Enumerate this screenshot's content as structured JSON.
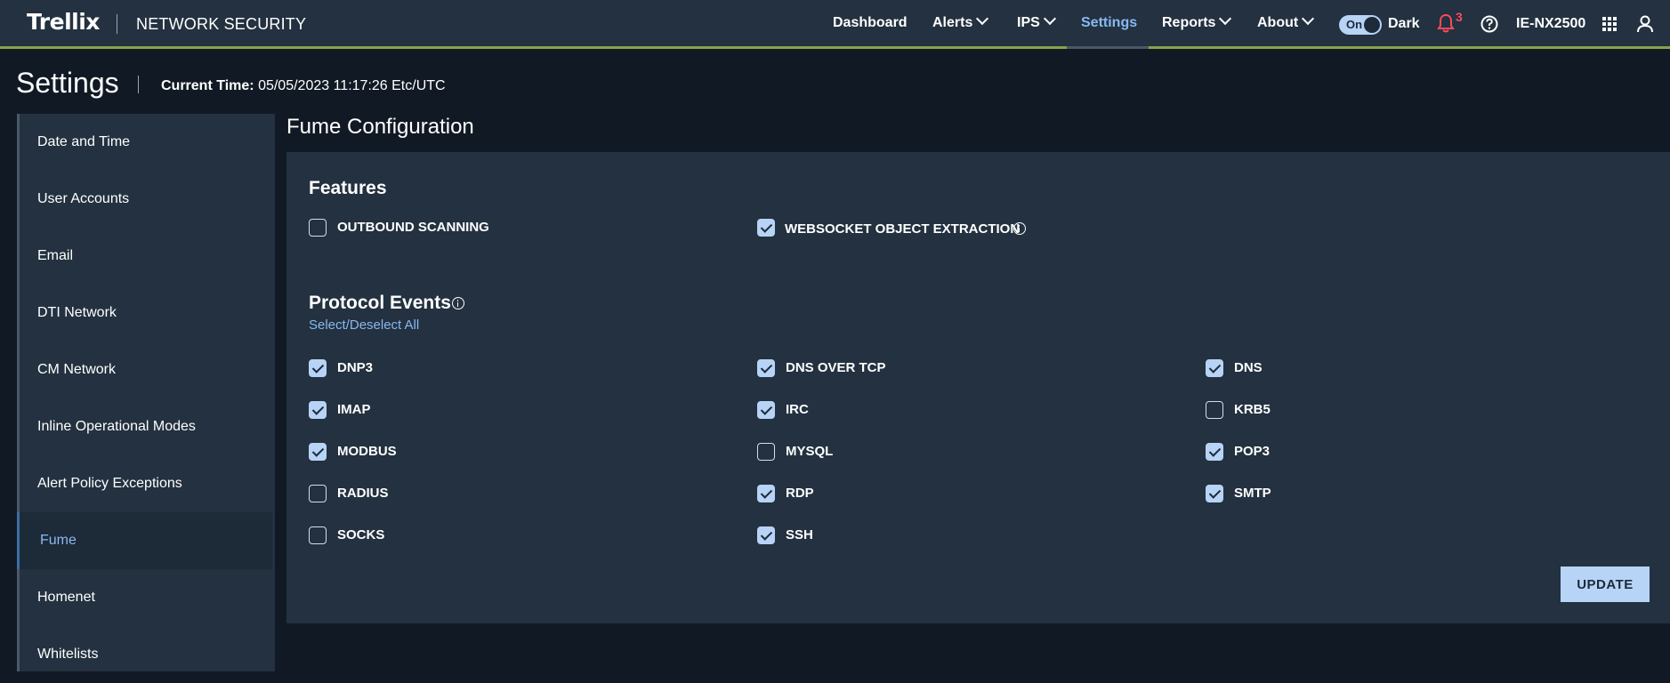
{
  "header": {
    "logo": "Trellix",
    "product": "NETWORK SECURITY",
    "nav": [
      {
        "label": "Dashboard"
      },
      {
        "label": "Alerts"
      },
      {
        "label": "IPS"
      },
      {
        "label": "Settings"
      },
      {
        "label": "Reports"
      },
      {
        "label": "About"
      }
    ],
    "toggle_label": "On",
    "theme_label": "Dark",
    "notification_count": "3",
    "device_name": "IE-NX2500",
    "accent_color": "#8ab8f0",
    "alert_color": "#ff4a5a"
  },
  "page": {
    "title": "Settings",
    "time_label": "Current Time:",
    "time_value": "05/05/2023 11:17:26 Etc/UTC"
  },
  "sidebar": {
    "items": [
      {
        "label": "Date and Time"
      },
      {
        "label": "User Accounts"
      },
      {
        "label": "Email"
      },
      {
        "label": "DTI Network"
      },
      {
        "label": "CM Network"
      },
      {
        "label": "Inline Operational Modes"
      },
      {
        "label": "Alert Policy Exceptions"
      },
      {
        "label": "Fume"
      },
      {
        "label": "Homenet"
      },
      {
        "label": "Whitelists"
      }
    ],
    "active": "Fume"
  },
  "main": {
    "title": "Fume Configuration",
    "features": {
      "title": "Features",
      "items": [
        {
          "label": "OUTBOUND SCANNING",
          "checked": false
        },
        {
          "label": "WEBSOCKET OBJECT EXTRACTION",
          "checked": true
        }
      ]
    },
    "protocol_events": {
      "title": "Protocol Events",
      "select_all": "Select/Deselect All",
      "items": [
        {
          "label": "DNP3",
          "checked": true
        },
        {
          "label": "DNS OVER TCP",
          "checked": true
        },
        {
          "label": "DNS",
          "checked": true
        },
        {
          "label": "IMAP",
          "checked": true
        },
        {
          "label": "IRC",
          "checked": true
        },
        {
          "label": "KRB5",
          "checked": false
        },
        {
          "label": "MODBUS",
          "checked": true
        },
        {
          "label": "MYSQL",
          "checked": false
        },
        {
          "label": "POP3",
          "checked": true
        },
        {
          "label": "RADIUS",
          "checked": false
        },
        {
          "label": "RDP",
          "checked": true
        },
        {
          "label": "SMTP",
          "checked": true
        },
        {
          "label": "SOCKS",
          "checked": false
        },
        {
          "label": "SSH",
          "checked": true
        }
      ]
    },
    "update_label": "UPDATE"
  }
}
